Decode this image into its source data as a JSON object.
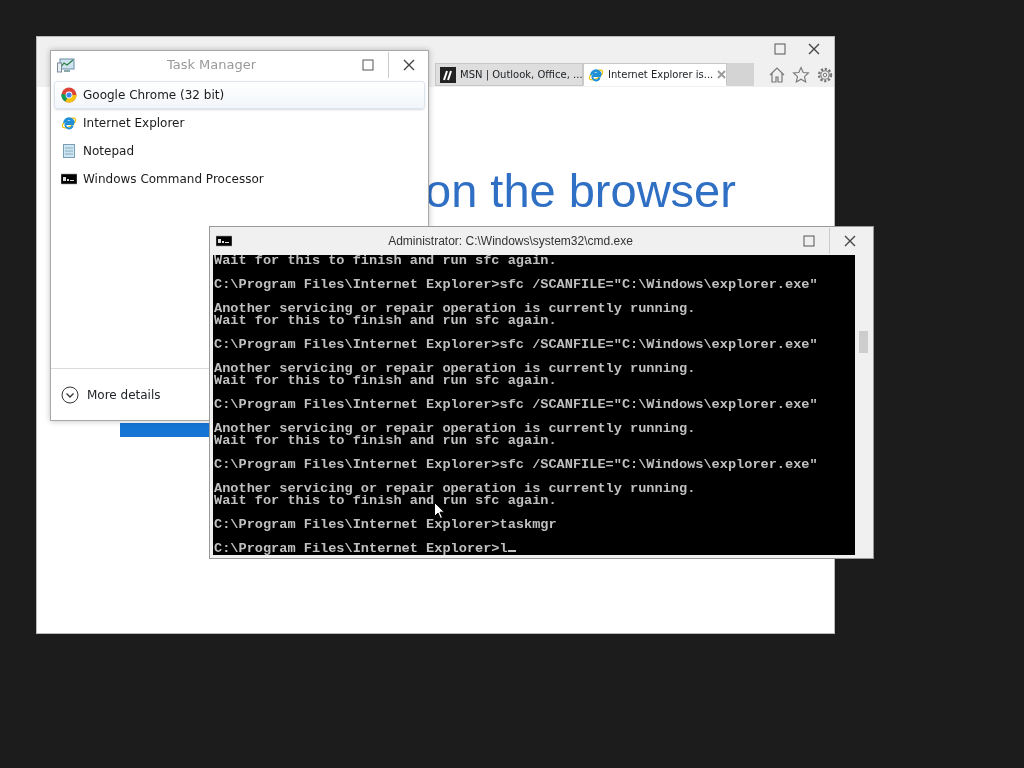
{
  "browser": {
    "tabs": [
      {
        "label": "MSN | Outlook, Office, ...",
        "selected": false,
        "kind": "msn",
        "closable": false
      },
      {
        "label": "Internet Explorer is...",
        "selected": true,
        "kind": "ie",
        "closable": true
      }
    ],
    "heading": "on the browser"
  },
  "task_manager": {
    "title": "Task Manager",
    "apps": [
      {
        "name": "Google Chrome (32 bit)",
        "selected": true,
        "kind": "chrome"
      },
      {
        "name": "Internet Explorer",
        "selected": false,
        "kind": "ie"
      },
      {
        "name": "Notepad",
        "selected": false,
        "kind": "notepad"
      },
      {
        "name": "Windows Command Processor",
        "selected": false,
        "kind": "cmd"
      }
    ],
    "more_details": "More details"
  },
  "console": {
    "title": "Administrator: C:\\Windows\\system32\\cmd.exe",
    "cursor": true,
    "lines": [
      {
        "text": "Wait for this to finish and run sfc again.",
        "gap_before": false
      },
      {
        "text": "C:\\Program Files\\Internet Explorer>sfc /SCANFILE=\"C:\\Windows\\explorer.exe\"",
        "gap_before": true
      },
      {
        "text": "Another servicing or repair operation is currently running.",
        "gap_before": true
      },
      {
        "text": "Wait for this to finish and run sfc again.",
        "gap_before": false
      },
      {
        "text": "C:\\Program Files\\Internet Explorer>sfc /SCANFILE=\"C:\\Windows\\explorer.exe\"",
        "gap_before": true
      },
      {
        "text": "Another servicing or repair operation is currently running.",
        "gap_before": true
      },
      {
        "text": "Wait for this to finish and run sfc again.",
        "gap_before": false
      },
      {
        "text": "C:\\Program Files\\Internet Explorer>sfc /SCANFILE=\"C:\\Windows\\explorer.exe\"",
        "gap_before": true
      },
      {
        "text": "Another servicing or repair operation is currently running.",
        "gap_before": true
      },
      {
        "text": "Wait for this to finish and run sfc again.",
        "gap_before": false
      },
      {
        "text": "C:\\Program Files\\Internet Explorer>sfc /SCANFILE=\"C:\\Windows\\explorer.exe\"",
        "gap_before": true
      },
      {
        "text": "Another servicing or repair operation is currently running.",
        "gap_before": true
      },
      {
        "text": "Wait for this to finish and run sfc again.",
        "gap_before": false
      },
      {
        "text": "C:\\Program Files\\Internet Explorer>taskmgr",
        "gap_before": true
      },
      {
        "text": "C:\\Program Files\\Internet Explorer>l",
        "gap_before": true
      }
    ]
  }
}
